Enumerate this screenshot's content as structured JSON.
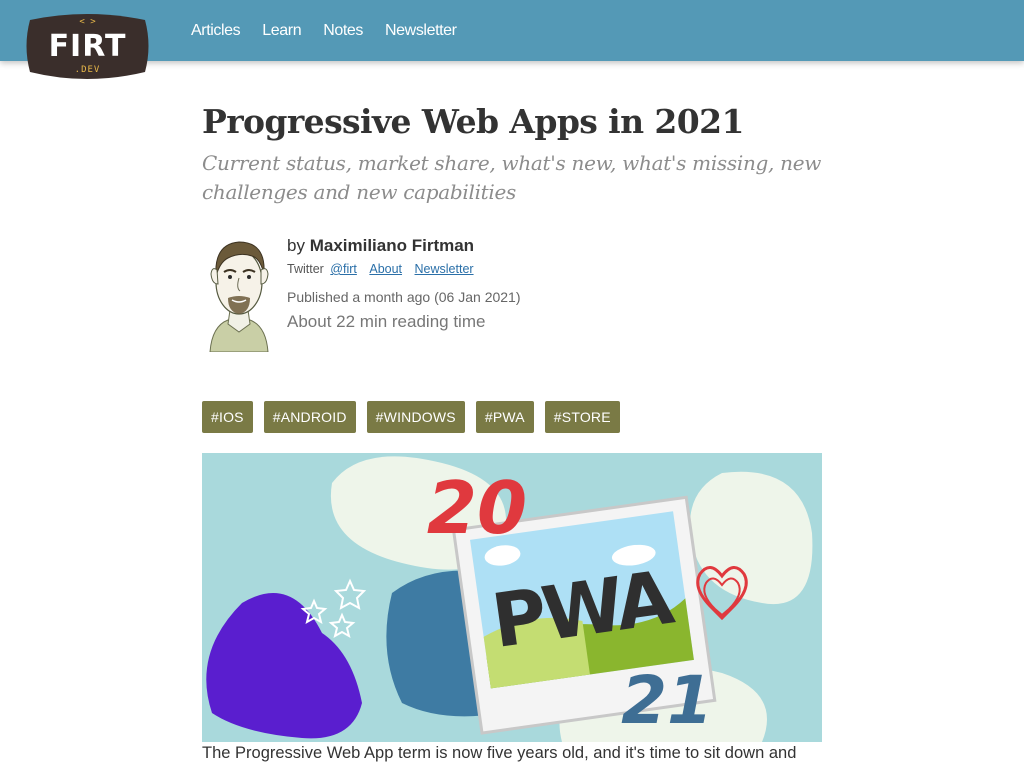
{
  "header": {
    "logo": {
      "code_mark": "< >",
      "text": "FIRT",
      "subtext": ".DEV"
    },
    "nav": [
      "Articles",
      "Learn",
      "Notes",
      "Newsletter"
    ],
    "colors": {
      "bar": "#5499b6",
      "logo_bg": "#3a2e2b"
    }
  },
  "article": {
    "title": "Progressive Web Apps in 2021",
    "subtitle": "Current status, market share, what's new, what's missing, new challenges and new capabilities",
    "author": {
      "by": "by",
      "name": "Maximiliano Firtman",
      "twitter_label": "Twitter",
      "twitter_handle": "@firt",
      "about": "About",
      "newsletter": "Newsletter"
    },
    "published": "Published a month ago (06 Jan 2021)",
    "reading_time": "About 22 min reading time",
    "tags": [
      "#IOS",
      "#ANDROID",
      "#WINDOWS",
      "#PWA",
      "#STORE"
    ],
    "tag_color": "#7a7a45",
    "hero": {
      "top_number": "20",
      "bottom_number": "21",
      "word": "PWA"
    },
    "intro": "The Progressive Web App term is now five years old, and it's time to sit down and"
  }
}
